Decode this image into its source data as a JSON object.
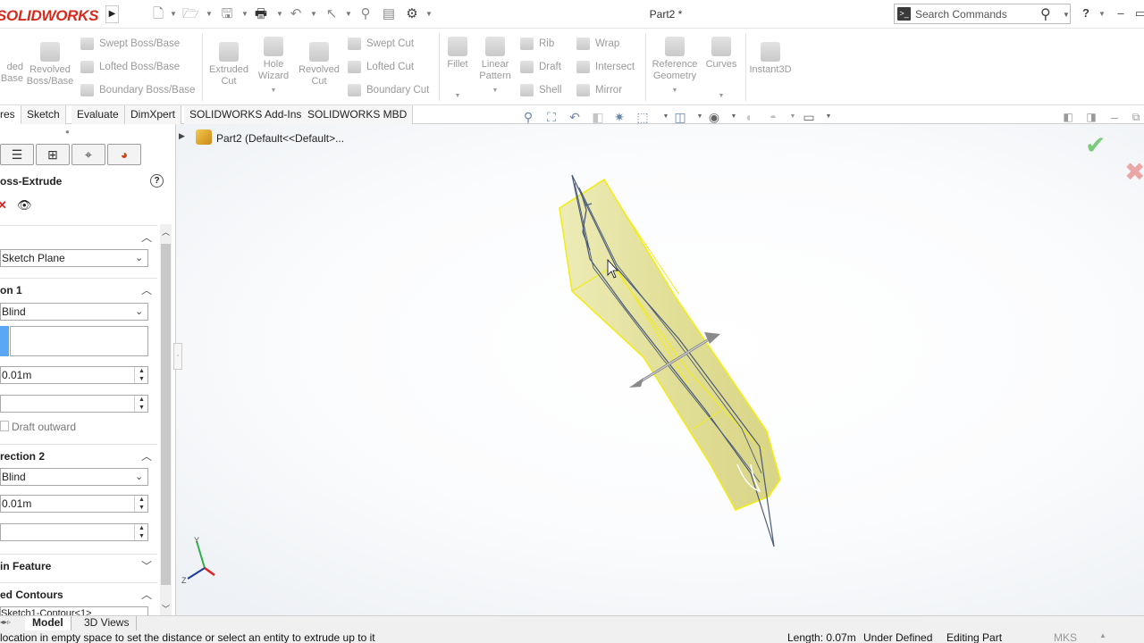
{
  "app": {
    "logo": "SOLIDWORKS",
    "doc_title": "Part2 *"
  },
  "search": {
    "placeholder": "Search Commands"
  },
  "ribbon": {
    "extruded_boss": "ded\nBase",
    "revolved_boss": "Revolved\nBoss/Base",
    "swept_boss": "Swept Boss/Base",
    "lofted_boss": "Lofted Boss/Base",
    "boundary_boss": "Boundary Boss/Base",
    "extruded_cut": "Extruded\nCut",
    "hole_wizard": "Hole\nWizard",
    "revolved_cut": "Revolved\nCut",
    "swept_cut": "Swept Cut",
    "lofted_cut": "Lofted Cut",
    "boundary_cut": "Boundary Cut",
    "fillet": "Fillet",
    "linear_pattern": "Linear\nPattern",
    "rib": "Rib",
    "draft": "Draft",
    "shell": "Shell",
    "wrap": "Wrap",
    "intersect": "Intersect",
    "mirror": "Mirror",
    "reference_geometry": "Reference\nGeometry",
    "curves": "Curves",
    "instant3d": "Instant3D"
  },
  "tabs": [
    "res",
    "Sketch",
    "Evaluate",
    "DimXpert",
    "SOLIDWORKS Add-Ins",
    "SOLIDWORKS MBD"
  ],
  "tree": {
    "item": "Part2  (Default<<Default>..."
  },
  "panel": {
    "title": "oss-Extrude",
    "from_value": "Sketch Plane",
    "direction1_title": "on 1",
    "end_condition1": "Blind",
    "depth1": "0.01m",
    "draft_outward": "Draft outward",
    "direction2_title": "rection 2",
    "end_condition2": "Blind",
    "depth2": "0.01m",
    "thin_feature": "in Feature",
    "selected_contours": "ed Contours",
    "contour_item": "Sketch1-Contour<1>"
  },
  "bottom_tabs": [
    "Model",
    "3D Views"
  ],
  "status": {
    "message": "location in empty space to set the distance or select an entity to extrude up to it",
    "length": "Length: 0.07m",
    "defined": "Under Defined",
    "editing": "Editing Part",
    "units": "MKS"
  },
  "colors": {
    "model_fill": "#e8e6a0",
    "model_edge": "#f2ec1a",
    "logo": "#d52b1e",
    "accept": "#7dc97d",
    "cancel": "#e89a9a"
  }
}
